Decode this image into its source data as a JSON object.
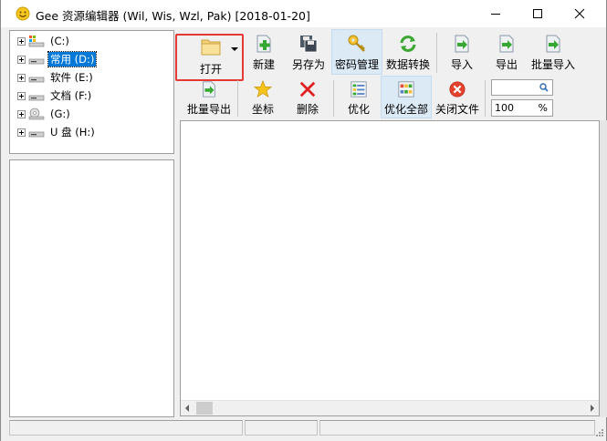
{
  "window": {
    "title": "Gee 资源编辑器 (Wil, Wis, Wzl, Pak) [2018-01-20]",
    "app_icon": "smiley-icon",
    "controls": [
      "minimize-icon",
      "maximize-icon",
      "close-icon"
    ]
  },
  "tree": {
    "items": [
      {
        "label": "(C:)",
        "icon": "system-drive-icon",
        "selected": false
      },
      {
        "label": "常用 (D:)",
        "icon": "drive-icon",
        "selected": true
      },
      {
        "label": "软件 (E:)",
        "icon": "drive-icon",
        "selected": false
      },
      {
        "label": "文档 (F:)",
        "icon": "drive-icon",
        "selected": false
      },
      {
        "label": "(G:)",
        "icon": "cd-drive-icon",
        "selected": false
      },
      {
        "label": "U 盘 (H:)",
        "icon": "drive-icon",
        "selected": false
      }
    ]
  },
  "toolbar": {
    "open": "打开",
    "new": "新建",
    "save_as": "另存为",
    "password": "密码管理",
    "convert": "数据转换",
    "import": "导入",
    "export": "导出",
    "batch_import": "批量导入",
    "batch_export": "批量导出",
    "coordinates": "坐标",
    "delete": "删除",
    "optimize": "优化",
    "optimize_all": "优化全部",
    "close_file": "关闭文件"
  },
  "zoom": {
    "value": "100",
    "unit": "%"
  },
  "colors": {
    "highlight": "#e53935",
    "selection": "#0078d7"
  }
}
